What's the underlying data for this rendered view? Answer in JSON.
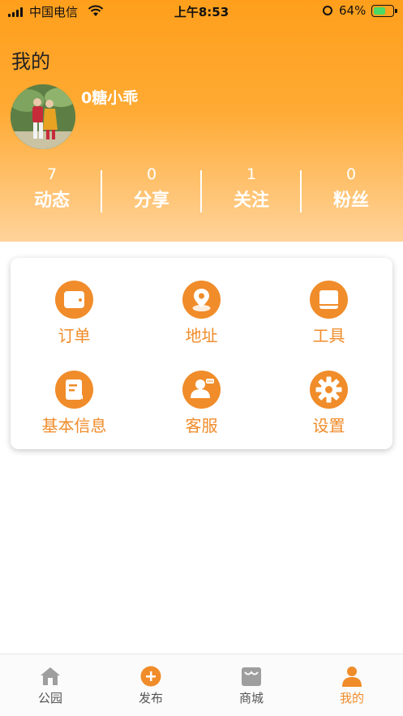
{
  "status_bar": {
    "carrier": "中国电信",
    "time": "上午8:53",
    "battery": "64%"
  },
  "header": {
    "title": "我的",
    "username": "0糖小乖"
  },
  "stats": [
    {
      "num": "7",
      "label": "动态"
    },
    {
      "num": "0",
      "label": "分享"
    },
    {
      "num": "1",
      "label": "关注"
    },
    {
      "num": "0",
      "label": "粉丝"
    }
  ],
  "menu": [
    {
      "label": "订单",
      "icon": "wallet-icon"
    },
    {
      "label": "地址",
      "icon": "location-icon"
    },
    {
      "label": "工具",
      "icon": "toolbox-icon"
    },
    {
      "label": "基本信息",
      "icon": "document-icon"
    },
    {
      "label": "客服",
      "icon": "customer-service-icon"
    },
    {
      "label": "设置",
      "icon": "gear-icon"
    }
  ],
  "tabbar": [
    {
      "label": "公园",
      "icon": "home-icon"
    },
    {
      "label": "发布",
      "icon": "add-icon"
    },
    {
      "label": "商城",
      "icon": "shop-icon"
    },
    {
      "label": "我的",
      "icon": "user-icon",
      "active": true
    }
  ],
  "colors": {
    "accent": "#F08C2A",
    "header_top": "#FF9F1C",
    "header_bottom": "#FFD39A"
  }
}
